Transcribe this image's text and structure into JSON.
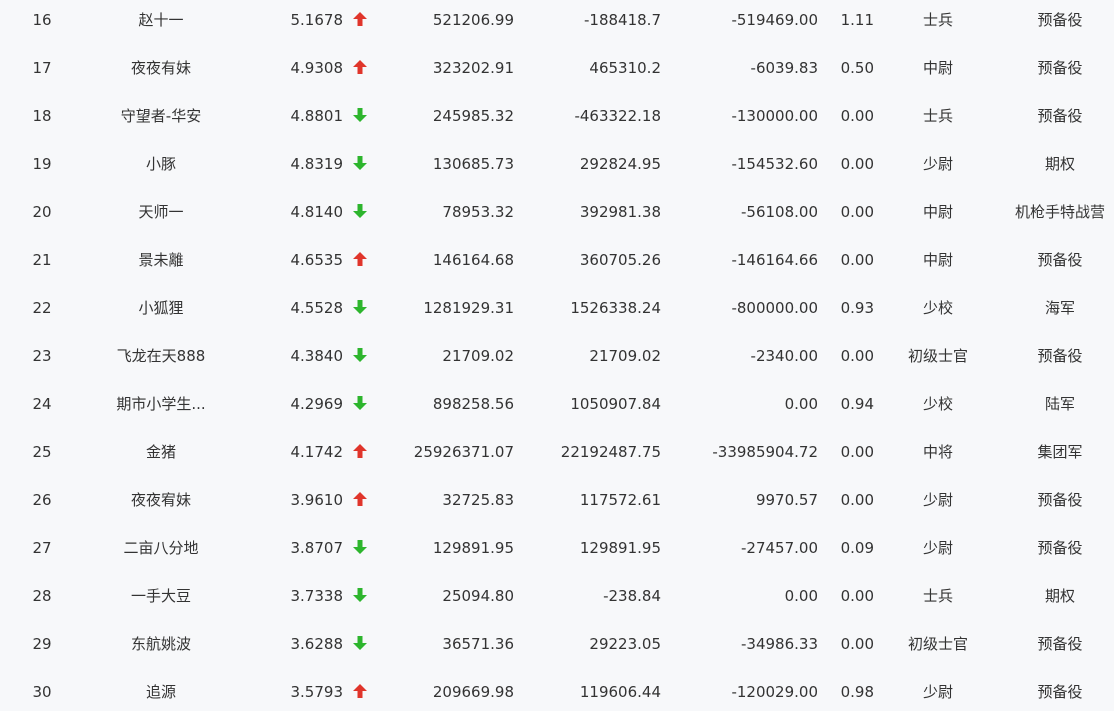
{
  "colors": {
    "background": "#f7f8fa",
    "text": "#333333",
    "up": "#e0352b",
    "down": "#2db52d"
  },
  "rows": [
    {
      "rank": "16",
      "name": "赵十一",
      "score": "5.1678",
      "trend": "up",
      "v1": "521206.99",
      "v2": "-188418.7",
      "v3": "-519469.00",
      "ratio": "1.11",
      "rank_name": "士兵",
      "group": "预备役"
    },
    {
      "rank": "17",
      "name": "夜夜有妹",
      "score": "4.9308",
      "trend": "up",
      "v1": "323202.91",
      "v2": "465310.2",
      "v3": "-6039.83",
      "ratio": "0.50",
      "rank_name": "中尉",
      "group": "预备役"
    },
    {
      "rank": "18",
      "name": "守望者-华安",
      "score": "4.8801",
      "trend": "down",
      "v1": "245985.32",
      "v2": "-463322.18",
      "v3": "-130000.00",
      "ratio": "0.00",
      "rank_name": "士兵",
      "group": "预备役"
    },
    {
      "rank": "19",
      "name": "小豚",
      "score": "4.8319",
      "trend": "down",
      "v1": "130685.73",
      "v2": "292824.95",
      "v3": "-154532.60",
      "ratio": "0.00",
      "rank_name": "少尉",
      "group": "期权"
    },
    {
      "rank": "20",
      "name": "天师一",
      "score": "4.8140",
      "trend": "down",
      "v1": "78953.32",
      "v2": "392981.38",
      "v3": "-56108.00",
      "ratio": "0.00",
      "rank_name": "中尉",
      "group": "机枪手特战营"
    },
    {
      "rank": "21",
      "name": "景未離",
      "score": "4.6535",
      "trend": "up",
      "v1": "146164.68",
      "v2": "360705.26",
      "v3": "-146164.66",
      "ratio": "0.00",
      "rank_name": "中尉",
      "group": "预备役"
    },
    {
      "rank": "22",
      "name": "小狐狸",
      "score": "4.5528",
      "trend": "down",
      "v1": "1281929.31",
      "v2": "1526338.24",
      "v3": "-800000.00",
      "ratio": "0.93",
      "rank_name": "少校",
      "group": "海军"
    },
    {
      "rank": "23",
      "name": "飞龙在天888",
      "score": "4.3840",
      "trend": "down",
      "v1": "21709.02",
      "v2": "21709.02",
      "v3": "-2340.00",
      "ratio": "0.00",
      "rank_name": "初级士官",
      "group": "预备役"
    },
    {
      "rank": "24",
      "name": "期市小学生...",
      "score": "4.2969",
      "trend": "down",
      "v1": "898258.56",
      "v2": "1050907.84",
      "v3": "0.00",
      "ratio": "0.94",
      "rank_name": "少校",
      "group": "陆军"
    },
    {
      "rank": "25",
      "name": "金猪",
      "score": "4.1742",
      "trend": "up",
      "v1": "25926371.07",
      "v2": "22192487.75",
      "v3": "-33985904.72",
      "ratio": "0.00",
      "rank_name": "中将",
      "group": "集团军"
    },
    {
      "rank": "26",
      "name": "夜夜宥妹",
      "score": "3.9610",
      "trend": "up",
      "v1": "32725.83",
      "v2": "117572.61",
      "v3": "9970.57",
      "ratio": "0.00",
      "rank_name": "少尉",
      "group": "预备役"
    },
    {
      "rank": "27",
      "name": "二亩八分地",
      "score": "3.8707",
      "trend": "down",
      "v1": "129891.95",
      "v2": "129891.95",
      "v3": "-27457.00",
      "ratio": "0.09",
      "rank_name": "少尉",
      "group": "预备役"
    },
    {
      "rank": "28",
      "name": "一手大豆",
      "score": "3.7338",
      "trend": "down",
      "v1": "25094.80",
      "v2": "-238.84",
      "v3": "0.00",
      "ratio": "0.00",
      "rank_name": "士兵",
      "group": "期权"
    },
    {
      "rank": "29",
      "name": "东航姚波",
      "score": "3.6288",
      "trend": "down",
      "v1": "36571.36",
      "v2": "29223.05",
      "v3": "-34986.33",
      "ratio": "0.00",
      "rank_name": "初级士官",
      "group": "预备役"
    },
    {
      "rank": "30",
      "name": "追源",
      "score": "3.5793",
      "trend": "up",
      "v1": "209669.98",
      "v2": "119606.44",
      "v3": "-120029.00",
      "ratio": "0.98",
      "rank_name": "少尉",
      "group": "预备役"
    }
  ]
}
